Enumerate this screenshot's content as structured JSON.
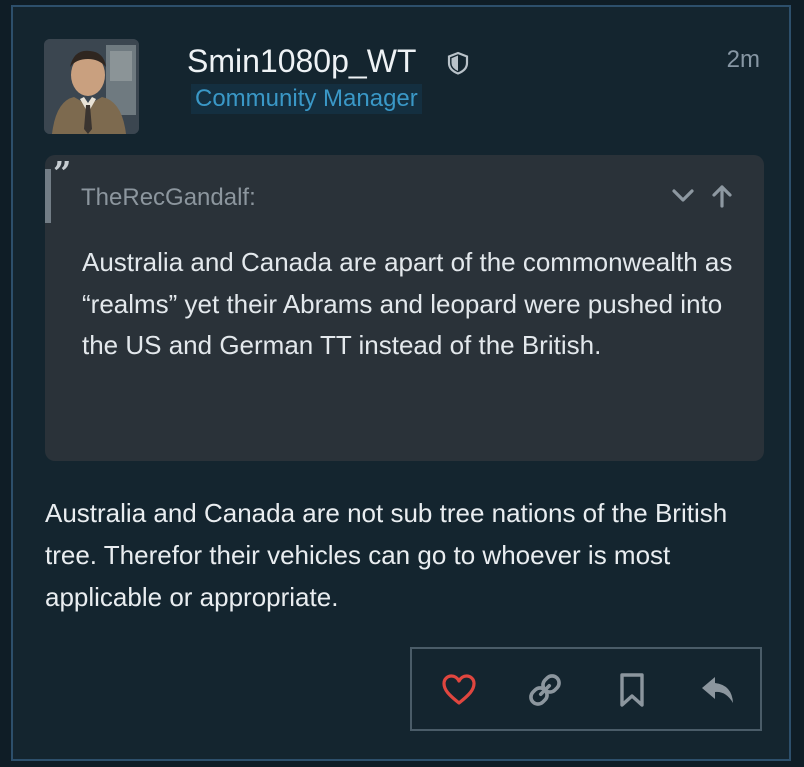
{
  "post": {
    "username": "Smin1080p_WT",
    "role": "Community Manager",
    "time": "2m",
    "quote": {
      "author": "TheRecGandalf:",
      "text": "Australia and Canada are apart of the commonwealth as “realms” yet their Abrams and leopard were pushed into the US and German TT instead of the British."
    },
    "body": "Australia and Canada are not sub tree nations of the British tree. Therefor their vehicles can go to whoever is most applicable or appropriate."
  },
  "icons": {
    "moderator": "shield-icon",
    "quote_mark": "quote-icon",
    "expand": "chevron-down-icon",
    "go_to_quoted": "arrow-up-icon",
    "like": "heart-icon",
    "share": "link-icon",
    "bookmark": "bookmark-icon",
    "reply": "reply-icon"
  },
  "colors": {
    "role": "#3a98c7",
    "like": "#e0463f",
    "background": "#14252f",
    "quote_background": "#2a3239"
  }
}
